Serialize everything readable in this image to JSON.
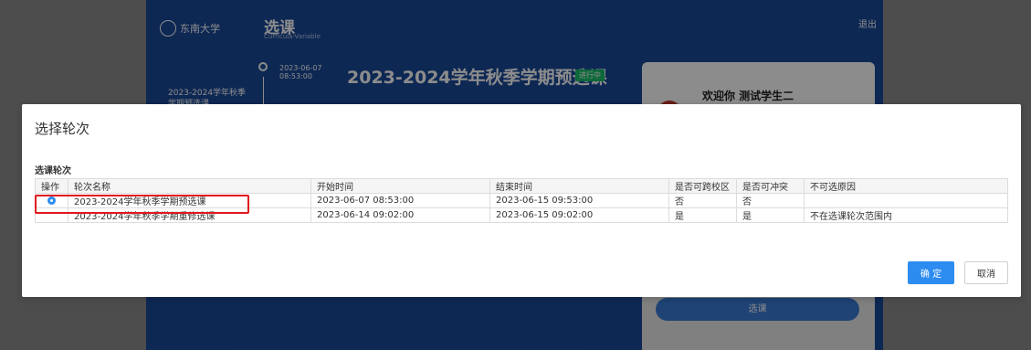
{
  "background": {
    "university_logo_text": "东南大学",
    "app_title": "选课",
    "app_subtitle": "Curricula-Variable",
    "logout_label": "退出",
    "timeline_date": "2023-06-07",
    "timeline_time": "08:53:00",
    "timeline_round_name": "2023-2024学年秋季学期预选课",
    "main_title": "2023-2024学年秋季学期预选课",
    "status_badge": "进行中",
    "welcome_text": "欢迎你 测试学生二",
    "select_button": "选课"
  },
  "modal": {
    "title": "选择轮次",
    "section_label": "选课轮次",
    "columns": [
      "操作",
      "轮次名称",
      "开始时间",
      "结束时间",
      "是否可跨校区",
      "是否可冲突",
      "不可选原因"
    ],
    "rows": [
      {
        "selected": true,
        "name": "2023-2024学年秋季学期预选课",
        "start": "2023-06-07 08:53:00",
        "end": "2023-06-15 09:53:00",
        "cross_campus": "否",
        "conflict": "否",
        "reason": ""
      },
      {
        "selected": false,
        "name": "2023-2024学年秋季学期重修选课",
        "start": "2023-06-14 09:02:00",
        "end": "2023-06-15 09:02:00",
        "cross_campus": "是",
        "conflict": "是",
        "reason": "不在选课轮次范围内"
      }
    ],
    "confirm_label": "确 定",
    "cancel_label": "取消"
  },
  "colors": {
    "primary": "#2d8cf0",
    "highlight": "#e0181e",
    "badge": "#19be6b"
  }
}
